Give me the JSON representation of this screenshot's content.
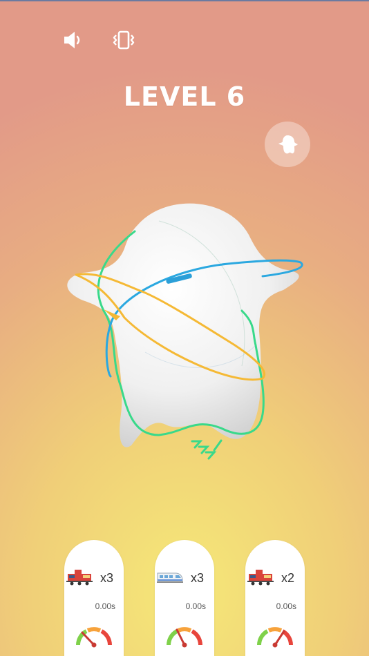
{
  "level": {
    "title": "LEVEL 6"
  },
  "icons": {
    "sound": "speaker-icon",
    "vibration": "vibrate-icon",
    "shape": "ghost-shape-icon"
  },
  "colors": {
    "track_yellow": "#f5b935",
    "track_blue": "#2ba8e0",
    "track_green": "#39d98a",
    "gauge_red": "#e8453c",
    "gauge_orange": "#f7a23b",
    "gauge_green": "#7fd14a"
  },
  "trains": [
    {
      "icon": "red-locomotive-icon",
      "count": "x3",
      "time": "0.00s"
    },
    {
      "icon": "white-bullet-train-icon",
      "count": "x3",
      "time": "0.00s"
    },
    {
      "icon": "red-locomotive-icon",
      "count": "x2",
      "time": "0.00s"
    }
  ]
}
